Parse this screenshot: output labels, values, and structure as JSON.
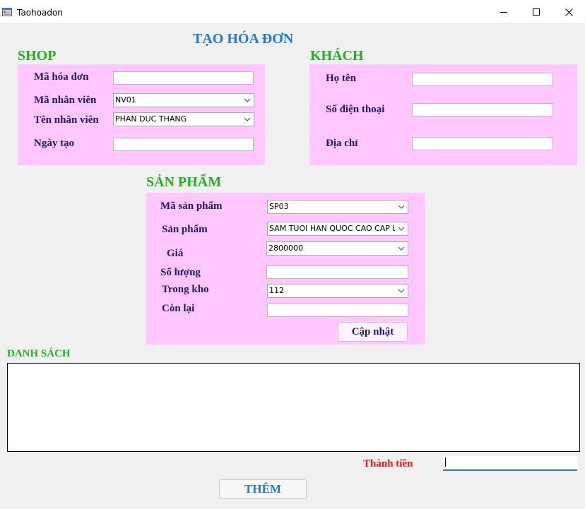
{
  "window": {
    "title": "Taohoadon",
    "icons": {
      "app": "form-app-icon",
      "minimize": "minimize-icon",
      "maximize": "maximize-icon",
      "close": "close-icon"
    }
  },
  "header": {
    "title": "TẠO HÓA ĐƠN"
  },
  "shop": {
    "heading": "SHOP",
    "invoice_id_label": "Mã hóa đơn",
    "invoice_id_value": "",
    "employee_id_label": "Mã nhân viên",
    "employee_id_value": "NV01",
    "employee_name_label": "Tên nhân viên",
    "employee_name_value": "PHAN DUC THANG",
    "date_label": "Ngày tạo",
    "date_value": ""
  },
  "customer": {
    "heading": "KHÁCH",
    "name_label": "Họ tên",
    "name_value": "",
    "phone_label": "Số điện thoại",
    "phone_value": "",
    "address_label": "Địa chỉ",
    "address_value": ""
  },
  "product": {
    "heading": "SẢN PHẨM",
    "code_label": "Mã sản phẩm",
    "code_value": "SP03",
    "name_label": "Sản phẩm",
    "name_value": "SAM TUOI HAN QUOC CAO CAP LO",
    "price_label": "Giá",
    "price_value": "2800000",
    "quantity_label": "Số lượng",
    "quantity_value": "",
    "stock_label": "Trong kho",
    "stock_value": "112",
    "remaining_label": "Còn lại",
    "remaining_value": "",
    "update_button": "Cập nhật"
  },
  "list": {
    "heading": "DANH SÁCH"
  },
  "total": {
    "label": "Thành tiền",
    "value": ""
  },
  "actions": {
    "add_button": "THÊM"
  },
  "colors": {
    "panel": "#ffc6ff",
    "title_blue": "#1e7bd6",
    "heading_green": "#1db31d",
    "label_navy": "#1a1a6e",
    "total_red": "#e01818"
  }
}
